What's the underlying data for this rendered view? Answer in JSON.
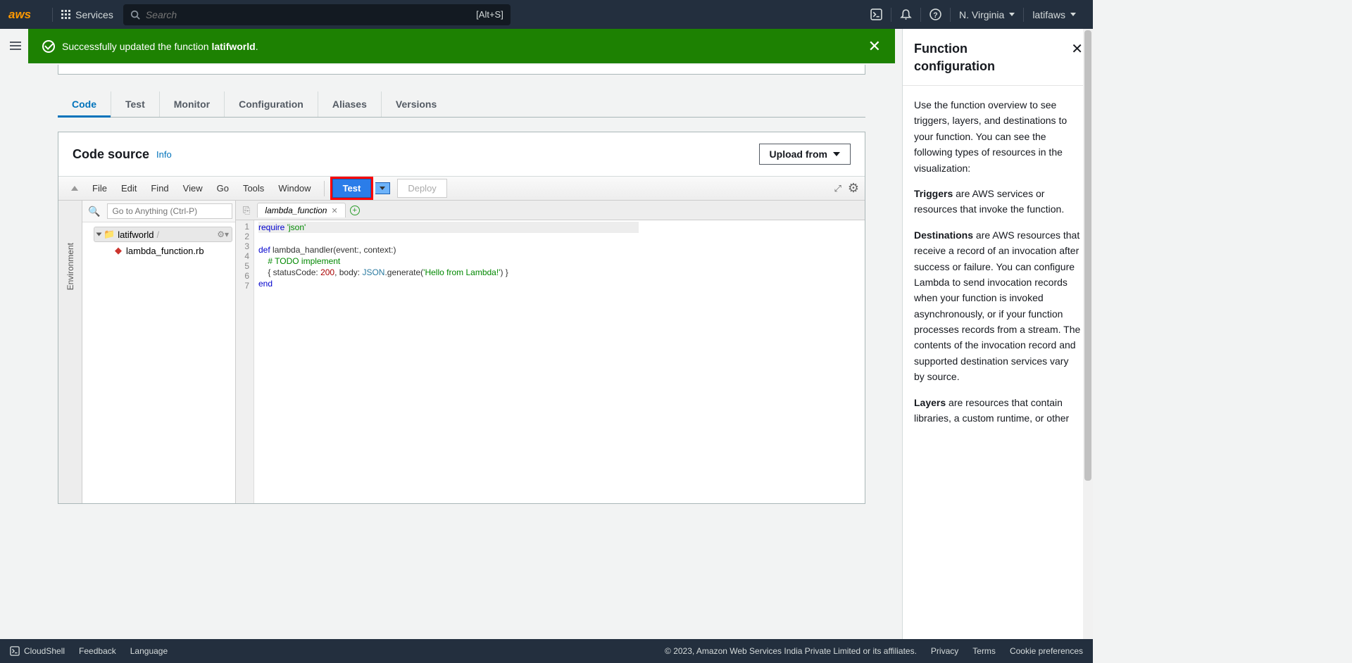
{
  "nav": {
    "logo": "aws",
    "services": "Services",
    "searchPlaceholder": "Search",
    "shortcut": "[Alt+S]",
    "region": "N. Virginia",
    "account": "latifaws"
  },
  "flash": {
    "prefix": "Successfully updated the function ",
    "name": "latifworld",
    "suffix": "."
  },
  "tabs": [
    "Code",
    "Test",
    "Monitor",
    "Configuration",
    "Aliases",
    "Versions"
  ],
  "panel": {
    "title": "Code source",
    "info": "Info",
    "uploadFrom": "Upload from"
  },
  "ide": {
    "menus": [
      "File",
      "Edit",
      "Find",
      "View",
      "Go",
      "Tools",
      "Window"
    ],
    "test": "Test",
    "deploy": "Deploy",
    "envLabel": "Environment",
    "gotoPlaceholder": "Go to Anything (Ctrl-P)",
    "folder": "latifworld",
    "folderSep": "/",
    "file": "lambda_function.rb",
    "tabName": "lambda_function",
    "code": {
      "l1a": "require",
      "l1b": "'json'",
      "l3a": "def",
      "l3b": " lambda_handler(event:, context:)",
      "l4": "    # TODO implement",
      "l5a": "    { statusCode: ",
      "l5num": "200",
      "l5b": ", body: ",
      "l5const": "JSON",
      "l5c": ".generate(",
      "l5str": "'Hello from Lambda!'",
      "l5d": ") }",
      "l6": "end"
    }
  },
  "docs": {
    "title1": "Function",
    "title2": "configuration",
    "p1": "Use the function overview to see triggers, layers, and destinations to your function. You can see the following types of resources in the visualization:",
    "p2a": "Triggers",
    "p2b": " are AWS services or resources that invoke the function.",
    "p3a": "Destinations",
    "p3b": " are AWS resources that receive a record of an invocation after success or failure. You can configure Lambda to send invocation records when your function is invoked asynchronously, or if your function processes records from a stream. The contents of the invocation record and supported destination services vary by source.",
    "p4a": "Layers",
    "p4b": " are resources that contain libraries, a custom runtime, or other"
  },
  "footer": {
    "cloudshell": "CloudShell",
    "feedback": "Feedback",
    "language": "Language",
    "copyright": "© 2023, Amazon Web Services India Private Limited or its affiliates.",
    "privacy": "Privacy",
    "terms": "Terms",
    "cookies": "Cookie preferences"
  }
}
